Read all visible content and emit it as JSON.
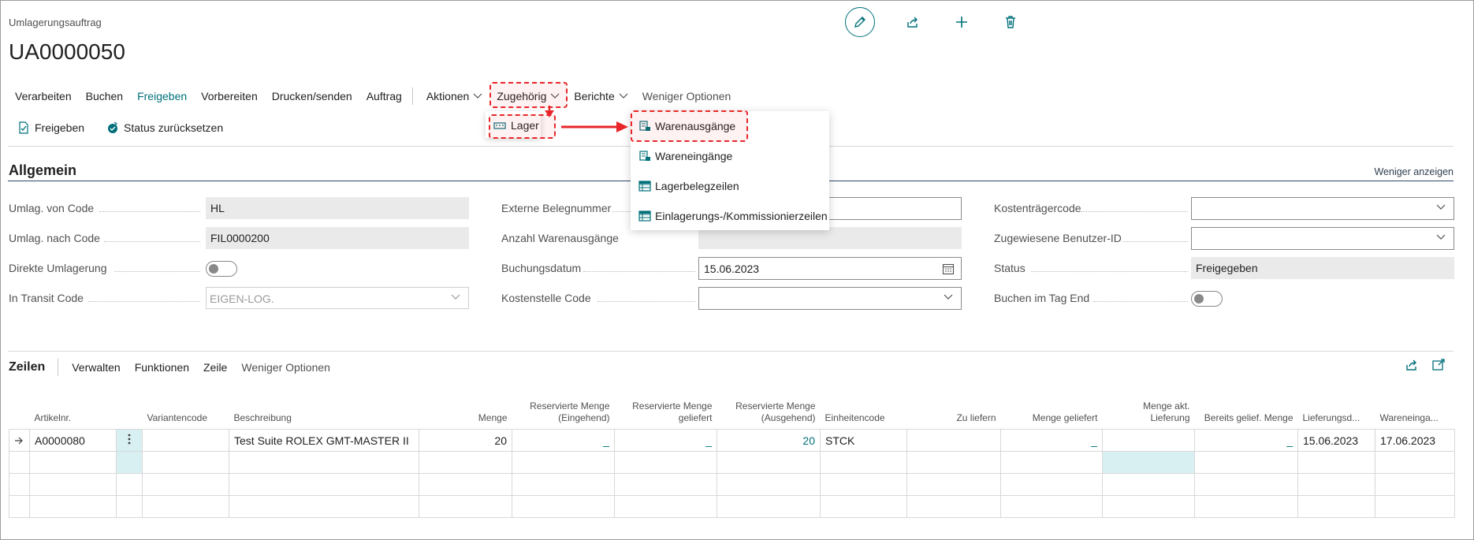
{
  "header": {
    "caption": "Umlagerungsauftrag",
    "doc_no": "UA0000050",
    "actions": [
      {
        "name": "edit-pencil-icon"
      },
      {
        "name": "share-icon"
      },
      {
        "name": "add-icon"
      },
      {
        "name": "delete-icon"
      }
    ]
  },
  "menu": {
    "verarbeiten": "Verarbeiten",
    "buchen": "Buchen",
    "freigeben": "Freigeben",
    "vorbereiten": "Vorbereiten",
    "drucken": "Drucken/senden",
    "auftrag": "Auftrag",
    "aktionen": "Aktionen",
    "zugehoerig": "Zugehörig",
    "berichte": "Berichte",
    "weniger": "Weniger Optionen"
  },
  "subbar": {
    "freigeben": "Freigeben",
    "status_reset": "Status zurücksetzen"
  },
  "dropdown": {
    "lager": "Lager"
  },
  "flyout": {
    "items": [
      "Warenausgänge",
      "Wareneingänge",
      "Lagerbelegzeilen",
      "Einlagerungs-/Kommissionierzeilen"
    ]
  },
  "general": {
    "title": "Allgemein",
    "less_link": "Weniger anzeigen",
    "umlag_von_label": "Umlag. von Code",
    "umlag_von_value": "HL",
    "umlag_nach_label": "Umlag. nach Code",
    "umlag_nach_value": "FIL0000200",
    "direkt_label": "Direkte Umlagerung",
    "transit_label": "In Transit Code",
    "transit_value": "EIGEN-LOG.",
    "ext_beleg_label": "Externe Belegnummer",
    "ext_beleg_value": "",
    "anzahl_label": "Anzahl Warenausgänge",
    "buchungsdatum_label": "Buchungsdatum",
    "buchungsdatum_value": "15.06.2023",
    "kostenstelle_label": "Kostenstelle Code",
    "kostentraeger_label": "Kostenträgercode",
    "benutzer_label": "Zugewiesene Benutzer-ID",
    "status_label": "Status",
    "status_value": "Freigegeben",
    "buchen_tag_label": "Buchen im Tag End"
  },
  "lines": {
    "title": "Zeilen",
    "verwalten": "Verwalten",
    "funktionen": "Funktionen",
    "zeile": "Zeile",
    "weniger": "Weniger Optionen",
    "columns": {
      "artikel": "Artikelnr.",
      "variante": "Variantencode",
      "beschreibung": "Beschreibung",
      "menge": "Menge",
      "res_eing": "Reservierte Menge (Eingehend)",
      "res_gelief": "Reservierte Menge geliefert",
      "res_ausg": "Reservierte Menge (Ausgehend)",
      "einheit": "Einheitencode",
      "zu_liefern": "Zu liefern",
      "menge_gelief": "Menge geliefert",
      "menge_akt": "Menge akt. Lieferung",
      "bereits": "Bereits gelief. Menge",
      "lieferungsd": "Lieferungsd...",
      "wareneinga": "Wareneinga..."
    },
    "row1": {
      "artikel": "A0000080",
      "beschreibung": "Test Suite ROLEX GMT-MASTER II",
      "menge": "20",
      "res_eing": "_",
      "res_gelief": "_",
      "res_ausg": "20",
      "einheit": "STCK",
      "menge_gelief": "_",
      "bereits": "_",
      "lieferungsd": "15.06.2023",
      "wareneinga": "17.06.2023"
    }
  },
  "colors": {
    "accent": "#00707a",
    "highlight": "#e8262a"
  }
}
